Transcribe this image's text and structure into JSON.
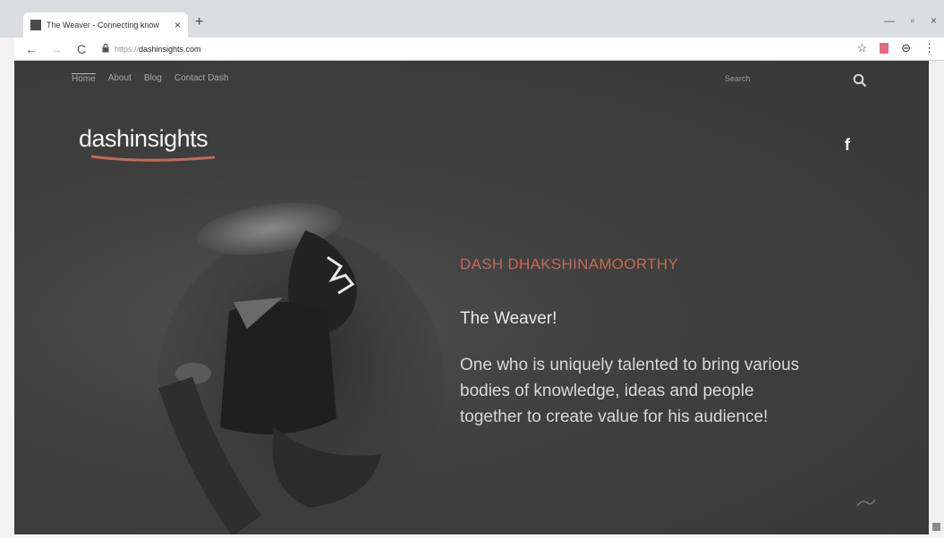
{
  "browser": {
    "tab_title": "The Weaver - Connecting know",
    "tab_close": "×",
    "new_tab": "+",
    "url_proto": "https://",
    "url_host": "dashinsights.com",
    "back": "←",
    "forward": "→",
    "reload": "C",
    "lock": "🔒",
    "star": "☆",
    "profile": "⊖",
    "menu": "⋮",
    "minimize": "—",
    "restore": "▫",
    "close": "×"
  },
  "site": {
    "nav": [
      "Home",
      "About",
      "Blog",
      "Contact Dash"
    ],
    "search_placeholder": "Search",
    "logo_a": "dash",
    "logo_b": "insights",
    "facebook": "f",
    "accent_color": "#c06a55"
  },
  "hero": {
    "name": "DASH DHAKSHINAMOORTHY",
    "tagline": "The Weaver!",
    "description": "One who is uniquely talented to bring various bodies of knowledge, ideas and people together to create value for his audience!"
  },
  "icons": {
    "search": "search-icon",
    "facebook": "facebook-icon",
    "lock": "lock-icon"
  }
}
